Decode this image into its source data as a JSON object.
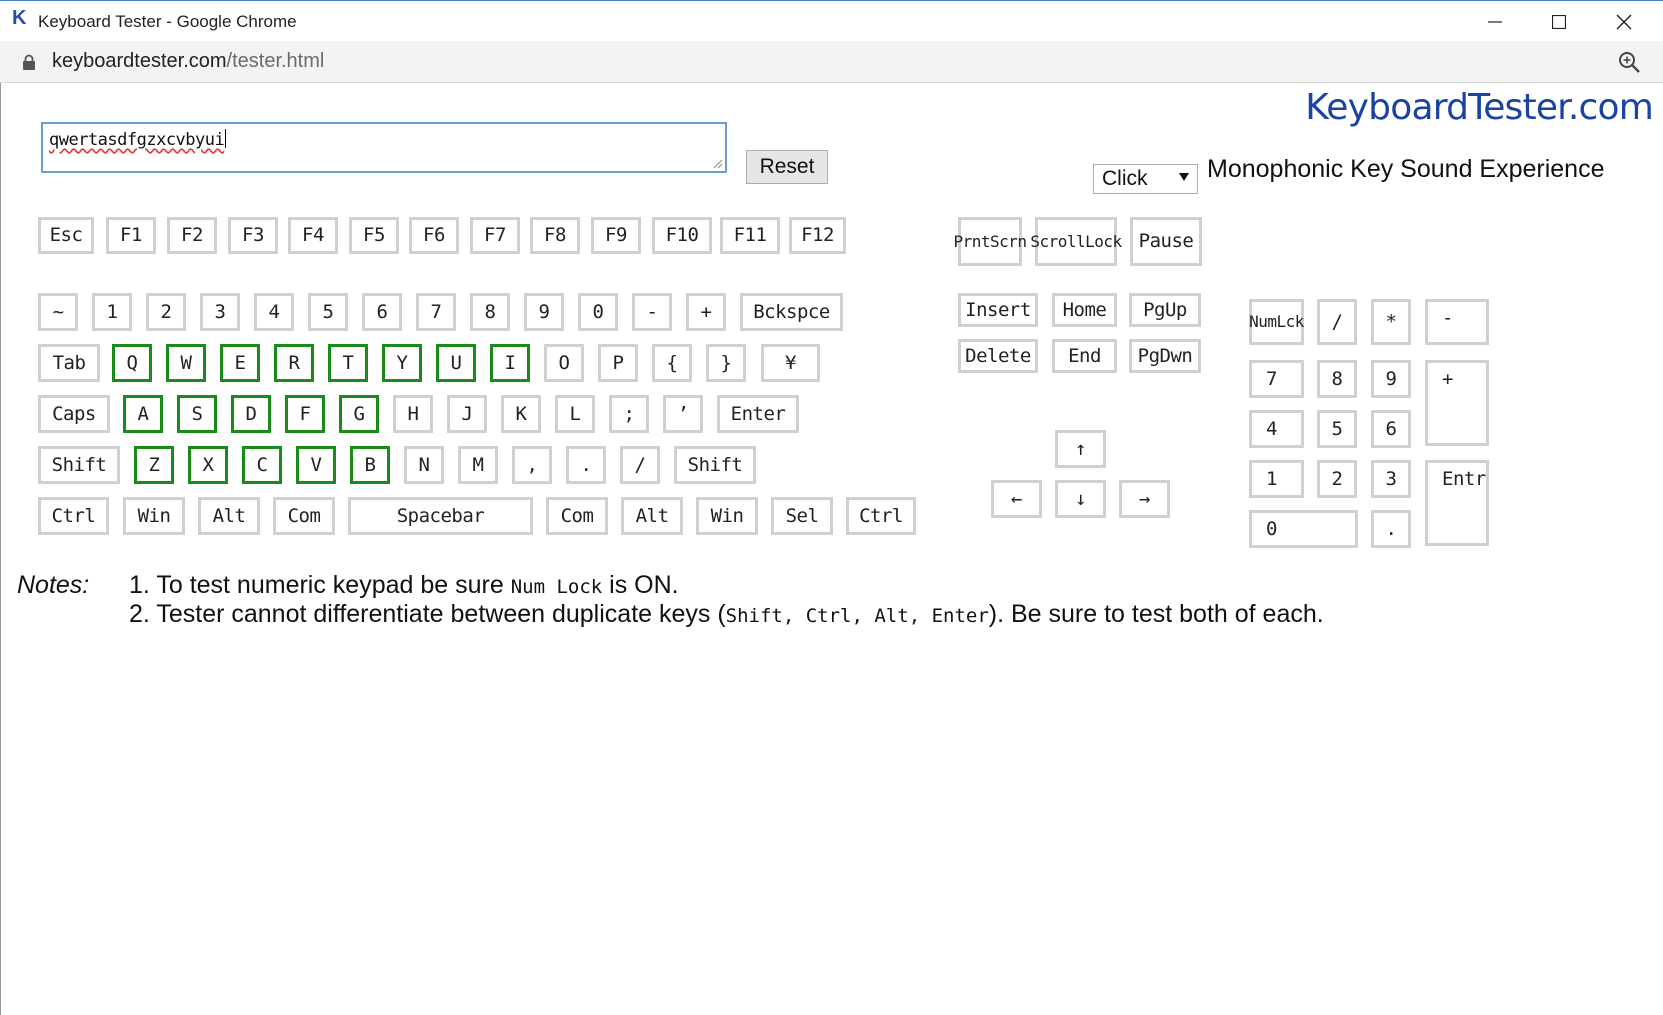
{
  "window": {
    "title": "Keyboard Tester - Google Chrome",
    "logo_letter": "K"
  },
  "address_bar": {
    "domain": "keyboardtester.com",
    "path": "/tester.html"
  },
  "brand": "KeyboardTester.com",
  "typed_text": "qwertasdfgzxcvbyui",
  "reset_label": "Reset",
  "sound": {
    "selected": "Click",
    "label": "Monophonic Key Sound Experience"
  },
  "keyboard": {
    "function_row": [
      "Esc",
      "F1",
      "F2",
      "F3",
      "F4",
      "F5",
      "F6",
      "F7",
      "F8",
      "F9",
      "F10",
      "F11",
      "F12"
    ],
    "number_row": [
      "~",
      "1",
      "2",
      "3",
      "4",
      "5",
      "6",
      "7",
      "8",
      "9",
      "0",
      "-",
      "+",
      "Bckspce"
    ],
    "qwerty_row": [
      "Tab",
      "Q",
      "W",
      "E",
      "R",
      "T",
      "Y",
      "U",
      "I",
      "O",
      "P",
      "{",
      "}",
      "¥"
    ],
    "home_row": [
      "Caps",
      "A",
      "S",
      "D",
      "F",
      "G",
      "H",
      "J",
      "K",
      "L",
      ";",
      "’",
      "Enter"
    ],
    "shift_row": [
      "Shift",
      "Z",
      "X",
      "C",
      "V",
      "B",
      "N",
      "M",
      ",",
      ".",
      "/",
      "Shift"
    ],
    "bottom_row": [
      "Ctrl",
      "Win",
      "Alt",
      "Com",
      "Spacebar",
      "Com",
      "Alt",
      "Win",
      "Sel",
      "Ctrl"
    ],
    "system_keys": [
      [
        "Prnt",
        "Scrn"
      ],
      [
        "Scroll",
        "Lock"
      ],
      "Pause"
    ],
    "nav_keys": [
      "Insert",
      "Home",
      "PgUp",
      "Delete",
      "End",
      "PgDwn"
    ],
    "arrow_keys": [
      "↑",
      "←",
      "↓",
      "→"
    ],
    "numpad": [
      [
        "Num",
        "Lck"
      ],
      "/",
      "*",
      "-",
      "7",
      "8",
      "9",
      "+",
      "4",
      "5",
      "6",
      "1",
      "2",
      "3",
      "Entr",
      "0",
      "."
    ],
    "pressed_keys": [
      "Q",
      "W",
      "E",
      "R",
      "T",
      "Y",
      "U",
      "I",
      "A",
      "S",
      "D",
      "F",
      "G",
      "Z",
      "X",
      "C",
      "V",
      "B"
    ]
  },
  "notes": {
    "label": "Notes:",
    "line1_pre": "1. To test numeric keypad be sure ",
    "line1_code": "Num Lock",
    "line1_post": " is ON.",
    "line2_pre": "2. Tester cannot differentiate between duplicate keys (",
    "line2_code": "Shift, Ctrl, Alt, Enter",
    "line2_post": "). Be sure to test both of each."
  },
  "colors": {
    "pressed_border": "#1a8a1a",
    "idle_border": "#d0d0d0",
    "brand": "#1a44a0"
  }
}
